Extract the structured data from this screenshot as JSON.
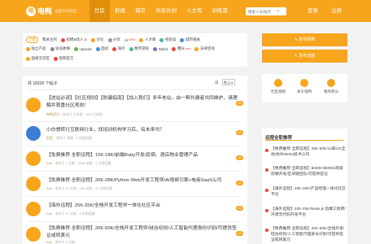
{
  "header": {
    "logo_badge": "电",
    "logo_text": "电鸭",
    "logo_sub": "远程工作社区",
    "nav": [
      "社区",
      "群组",
      "城市",
      "共享共创",
      "人才库",
      "训练营"
    ],
    "search_placeholder": "搜索人员/贴子",
    "search_icon": "search-icon",
    "login": "登录",
    "register": "注册",
    "accent": "#f7a51c"
  },
  "tags": {
    "row1": [
      {
        "label": "全部",
        "active": true
      },
      {
        "label": "我关注的"
      },
      {
        "label": "招聘&找人",
        "icon_color": "#e94b3c",
        "badge": "新"
      },
      {
        "label": "讨论",
        "icon_color": "#f7a51c"
      },
      {
        "label": "分享",
        "icon_color": "#999999"
      },
      {
        "label": "AI",
        "badge": "NEW"
      },
      {
        "label": "人才库",
        "icon_color": "#f7a51c"
      },
      {
        "label": "经验谈",
        "icon_color": "#49b8a5"
      },
      {
        "label": "城市相关",
        "icon_color": "#4a90d9"
      }
    ],
    "row2": [
      {
        "label": "独立产品",
        "icon_color": "#f7a51c"
      },
      {
        "label": "访谈故事",
        "icon_color": "#888888"
      },
      {
        "label": "Upwork",
        "icon_color": "#6fb24a"
      },
      {
        "label": "面试",
        "icon_color": "#4a90d9"
      },
      {
        "label": "海外",
        "icon_color": "#e94b3c"
      },
      {
        "label": "数字游民",
        "icon_color": "#49b8a5"
      },
      {
        "label": "Web3",
        "icon_color": "#7b6fd6"
      },
      {
        "label": "曝光",
        "icon_color": "#e94b3c",
        "badge": "new"
      },
      {
        "label": "法律咨询",
        "icon_color": "#f7a51c"
      }
    ],
    "row3": [
      {
        "label": "困惑交流区",
        "icon_color": "#f7a51c"
      },
      {
        "label": "电鸭官方",
        "icon_color": "#e94b3c"
      }
    ]
  },
  "posts": {
    "header": "共 18226 个帖子",
    "sort_label": "排",
    "sort_value": "默认",
    "items": [
      {
        "title": "【进站必读】【社区规则】【防骗指南】【加入我们】多年老站，由一帮共建者共同维护，请理解并尊重社区规则！",
        "pinned": true,
        "author": "电鸭官方",
        "meta": "发布于 3 年前 · 14.5 万浏览",
        "count": "96",
        "avatar_color": "#f7a51c",
        "avatar_emoji": "🦆"
      },
      {
        "title": "小白想转行互联网行业，找培训机构学习后，有未来吗？",
        "pinned": false,
        "author": "凯西",
        "meta": "发布于 刚刚 · 1 月前回复",
        "count": "16",
        "avatar_color": "#3b7fd4",
        "avatar_emoji": "🌐"
      },
      {
        "title": "【免费推荐·全职远程】15K-18K/前端Ruby开发/民宿、酒店物业管理产品",
        "pinned": false,
        "author": "Kali",
        "meta": "发布于 1 天前 · 4096 浏览 · 1 天前回复",
        "count": "16",
        "avatar_color": "#f7a51c",
        "avatar_emoji": "🦆"
      },
      {
        "title": "【免费推荐·全职远程】20K-28K/Python Web开发工程师/AI视频引擎+电商SaaS公司",
        "pinned": false,
        "author": "Kali",
        "meta": "发布于 11 天前 · 183 浏览 · 11 天前回复",
        "count": "16",
        "avatar_color": "#f7a51c",
        "avatar_emoji": "🦆"
      },
      {
        "title": "【海外远程】25K-35K/全栈开发工程师一体化社区平台",
        "pinned": false,
        "author": "Kali",
        "meta": "发布于 11 天前 · 5 天前回复",
        "count": "16",
        "avatar_color": "#f7a51c",
        "avatar_emoji": "🦆"
      },
      {
        "title": "【免费推荐·全职远程】20K-50K/全栈开发工程师/硅谷初创/人工智能代理身份识别/可提供签证或转美元",
        "pinned": false,
        "author": "Kali",
        "meta": "发布于 2 天前",
        "count": "16",
        "avatar_color": "#f7a51c",
        "avatar_emoji": "🦆"
      }
    ]
  },
  "actions": {
    "post_job": "发布招聘",
    "post_topic": "发布话题"
  },
  "rules": [
    {
      "label": "社区规则",
      "icon": "book-icon",
      "color": "#f7a51c"
    },
    {
      "label": "关于电鸭",
      "icon": "info-icon",
      "color": "#f7a51c"
    },
    {
      "label": "我的积分",
      "icon": "coin-icon",
      "color": "#f7a51c"
    }
  ],
  "hot": {
    "title": "远程全职推荐",
    "items": [
      "【免费推荐·全职远程】25K-50K/14薪/JS全栈/杭州Web3技术公司",
      "【免费推荐·全职远程】$4000-$6000/高级前端开发/区块链团队/可提供签证",
      "【海外远程】20K-30K/产品经理一体化社区平台",
      "【海外远程】20K-25K/Node.js 后端工程师/开源无代码开发平台",
      "【免费推荐·全职远程】20K-50K/全栈开发/硅谷初创/人工智能代理身份识别/可提供签证或转美元"
    ]
  }
}
